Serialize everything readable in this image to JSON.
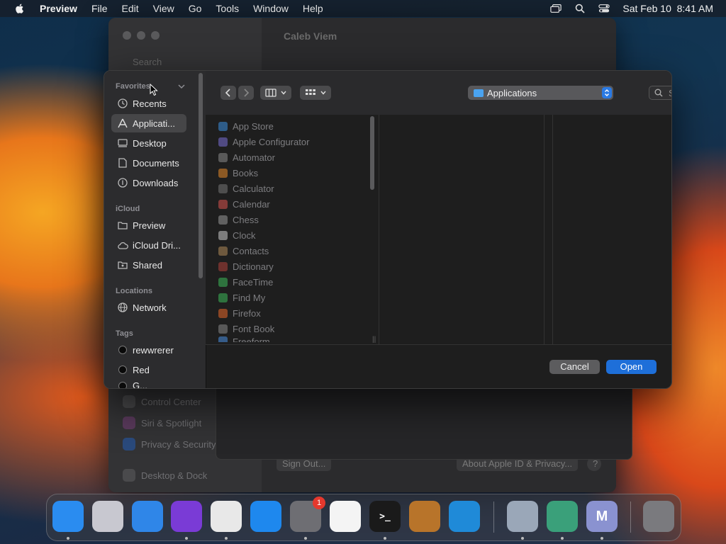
{
  "menubar": {
    "app_name": "Preview",
    "menus": [
      "File",
      "Edit",
      "View",
      "Go",
      "Tools",
      "Window",
      "Help"
    ],
    "datetime": "Sat Feb 10  8:41 AM"
  },
  "background_window": {
    "title": "Caleb Viem",
    "search_placeholder": "Search",
    "sidebar_items": [
      "Control Center",
      "Siri & Spotlight",
      "Privacy & Security",
      "Desktop & Dock"
    ],
    "buttons": {
      "sign_out": "Sign Out...",
      "about": "About Apple ID & Privacy...",
      "help": "?"
    }
  },
  "dialog": {
    "sidebar": {
      "favorites_header": "Favorites",
      "favorites": [
        {
          "label": "Recents",
          "icon": "clock-icon"
        },
        {
          "label": "Applicati...",
          "icon": "applications-icon",
          "selected": true
        },
        {
          "label": "Desktop",
          "icon": "desktop-icon"
        },
        {
          "label": "Documents",
          "icon": "document-icon"
        },
        {
          "label": "Downloads",
          "icon": "download-icon"
        }
      ],
      "icloud_header": "iCloud",
      "icloud": [
        {
          "label": "Preview",
          "icon": "folder-icon"
        },
        {
          "label": "iCloud Dri...",
          "icon": "cloud-icon"
        },
        {
          "label": "Shared",
          "icon": "shared-folder-icon"
        }
      ],
      "locations_header": "Locations",
      "locations": [
        {
          "label": "Network",
          "icon": "globe-icon"
        }
      ],
      "tags_header": "Tags",
      "tags": [
        {
          "label": "rewwrerer"
        },
        {
          "label": "Red"
        },
        {
          "label": "G..."
        }
      ]
    },
    "toolbar": {
      "location": "Applications",
      "search_placeholder": "Search"
    },
    "applications": [
      {
        "name": "App Store",
        "color": "#3d8fe0"
      },
      {
        "name": "Apple Configurator",
        "color": "#7a6fd6"
      },
      {
        "name": "Automator",
        "color": "#8a8a8a"
      },
      {
        "name": "Books",
        "color": "#e88a2a"
      },
      {
        "name": "Calculator",
        "color": "#777777"
      },
      {
        "name": "Calendar",
        "color": "#d9534f"
      },
      {
        "name": "Chess",
        "color": "#999999"
      },
      {
        "name": "Clock",
        "color": "#cccccc"
      },
      {
        "name": "Contacts",
        "color": "#b08a5a"
      },
      {
        "name": "Dictionary",
        "color": "#b0423a"
      },
      {
        "name": "FaceTime",
        "color": "#3cb95a"
      },
      {
        "name": "Find My",
        "color": "#3cb95a"
      },
      {
        "name": "Firefox",
        "color": "#e8682a"
      },
      {
        "name": "Font Book",
        "color": "#888888"
      },
      {
        "name": "Freeform",
        "color": "#4a90e2"
      }
    ],
    "buttons": {
      "cancel": "Cancel",
      "open": "Open"
    }
  },
  "dock": {
    "items": [
      {
        "name": "finder",
        "color": "#2a8cf0",
        "running": true
      },
      {
        "name": "launchpad",
        "color": "#c8c8d0",
        "running": false
      },
      {
        "name": "safari",
        "color": "#2f86e8",
        "running": false
      },
      {
        "name": "firefox",
        "color": "#7a3bd6",
        "running": true
      },
      {
        "name": "chrome",
        "color": "#e8e8e8",
        "running": true
      },
      {
        "name": "app-store",
        "color": "#1e88ee",
        "running": false
      },
      {
        "name": "system-settings",
        "color": "#6e6e73",
        "running": true,
        "badge": "1"
      },
      {
        "name": "textedit",
        "color": "#f4f4f4",
        "running": false
      },
      {
        "name": "terminal",
        "color": "#1a1a1a",
        "running": true,
        "glyph": ">_"
      },
      {
        "name": "garageband",
        "color": "#b8742a",
        "running": false
      },
      {
        "name": "vscode",
        "color": "#1f8ad8",
        "running": false
      },
      {
        "name": "preview",
        "color": "#9aa7b8",
        "running": true
      },
      {
        "name": "archive-utility",
        "color": "#3aa07a",
        "running": true
      },
      {
        "name": "m-app",
        "color": "#8a92d0",
        "running": true,
        "glyph": "M"
      },
      {
        "name": "trash",
        "color": "#7a7a7e",
        "running": false
      }
    ]
  }
}
